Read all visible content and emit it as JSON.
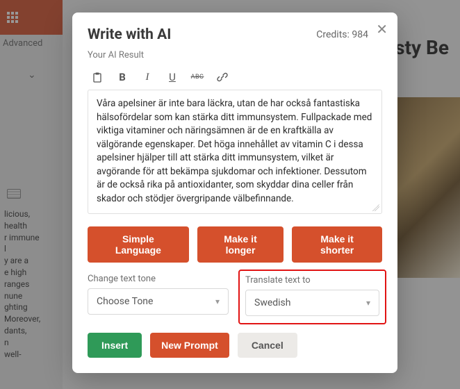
{
  "bg": {
    "advanced_tab": "Advanced",
    "title_fragment": "sty Be",
    "left_text": "licious,\n health\nr immune\nl\ny are a\ne high\nranges\nnune\nghting\nMoreover,\ndants,\nn\nwell-"
  },
  "modal": {
    "title": "Write with AI",
    "credits_label": "Credits: 984",
    "result_label": "Your AI Result",
    "editor_text": "Våra apelsiner är inte bara läckra, utan de har också fantastiska hälsofördelar som kan stärka ditt immunsystem. Fullpackade med viktiga vitaminer och näringsämnen är de en kraftkälla av välgörande egenskaper. Det höga innehållet av vitamin C i dessa apelsiner hjälper till att stärka ditt immunsystem, vilket är avgörande för att bekämpa sjukdomar och infektioner. Dessutom är de också rika på antioxidanter, som skyddar dina celler från skador och stödjer övergripande välbefinnande.",
    "quick": {
      "simple": "Simple Language",
      "longer": "Make it longer",
      "shorter": "Make it shorter"
    },
    "tone": {
      "label": "Change text tone",
      "value": "Choose Tone"
    },
    "translate": {
      "label": "Translate text to",
      "value": "Swedish"
    },
    "actions": {
      "insert": "Insert",
      "new_prompt": "New Prompt",
      "cancel": "Cancel"
    },
    "toolbar_icons": {
      "clipboard": "clipboard-icon",
      "bold": "B",
      "italic": "I",
      "underline": "U",
      "strike": "ABC",
      "link": "link-icon"
    }
  }
}
